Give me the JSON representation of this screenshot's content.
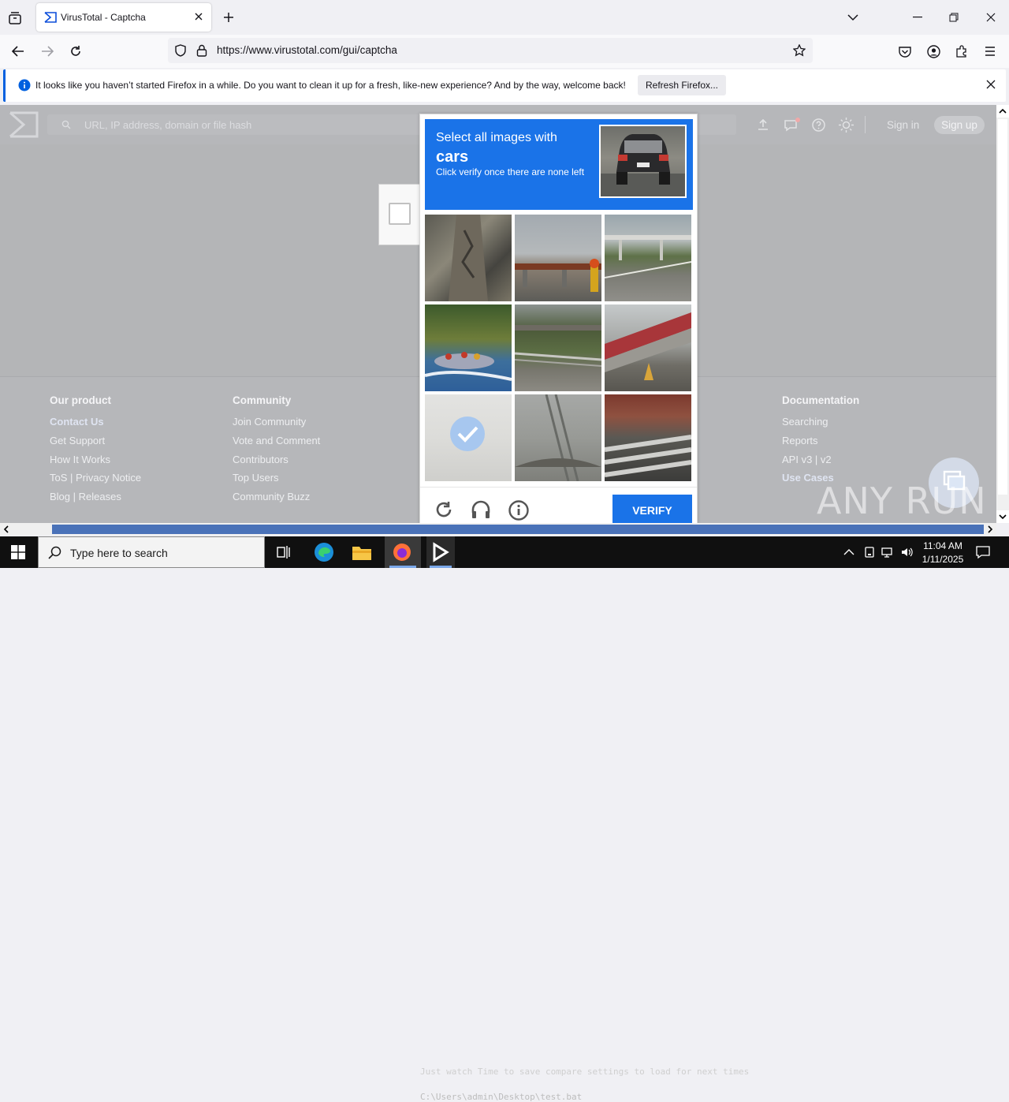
{
  "browser": {
    "tab_title": "VirusTotal - Captcha",
    "url": "https://www.virustotal.com/gui/captcha"
  },
  "notification": {
    "message": "It looks like you haven’t started Firefox in a while. Do you want to clean it up for a fresh, like-new experience? And by the way, welcome back!",
    "button": "Refresh Firefox..."
  },
  "vt": {
    "search_placeholder": "URL, IP address, domain or file hash",
    "sign_in": "Sign in",
    "sign_up": "Sign up"
  },
  "footer": {
    "columns": [
      {
        "head": "Our product",
        "links": [
          "Contact Us",
          "Get Support",
          "How It Works",
          "ToS | Privacy Notice",
          "Blog | Releases"
        ]
      },
      {
        "head": "Community",
        "links": [
          "Join Community",
          "Vote and Comment",
          "Contributors",
          "Top Users",
          "Community Buzz"
        ]
      },
      {
        "head": "Documentation",
        "links": [
          "Searching",
          "Reports",
          "API v3 | v2",
          "Use Cases"
        ]
      }
    ]
  },
  "captcha": {
    "line1": "Select all images with",
    "line2": "cars",
    "line3": "Click verify once there are none left",
    "verify": "VERIFY"
  },
  "taskbar": {
    "search_placeholder": "Type here to search",
    "time": "11:04 AM",
    "date": "1/11/2025",
    "console_line1": "Just watch Time to save compare settings to load for next times",
    "console_line2": "C:\\Users\\admin\\Desktop\\test.bat"
  },
  "watermark": "ANY RUN",
  "colors": {
    "accent": "#1a73e8",
    "firefox_blue": "#0060df",
    "taskbar": "#101010"
  }
}
